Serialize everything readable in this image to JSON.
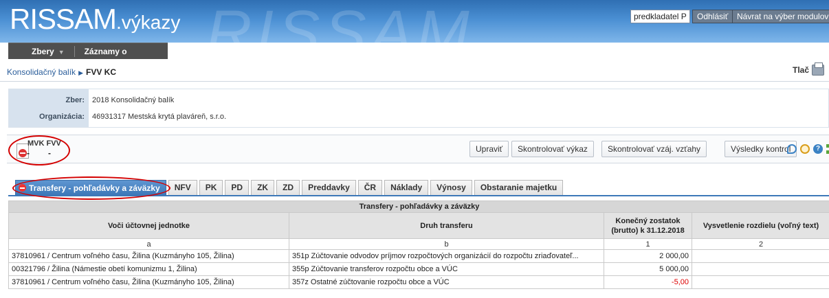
{
  "header": {
    "logo_main": "RISSAM",
    "logo_sub": ".výkazy",
    "watermark": "RISSAM",
    "user_value": "predkladatel P",
    "logout_label": "Odhlásiť",
    "back_label": "Návrat na výber modulov"
  },
  "nav": {
    "items": [
      "Zbery",
      "Záznamy o importe"
    ]
  },
  "breadcrumb": {
    "parent": "Konsolidačný balík",
    "current": "FVV KC",
    "print_label": "Tlač"
  },
  "info": {
    "zber_label": "Zber:",
    "zber_value": "2018 Konsolidačný balík",
    "org_label": "Organizácia:",
    "org_value": "46931317 Mestská krytá plaváreň, s.r.o."
  },
  "toolbar": {
    "names": "MVK  FVV",
    "dash1": "-",
    "dash2": "-",
    "buttons": [
      "Upraviť",
      "Skontrolovať výkaz",
      "Skontrolovať vzáj. vzťahy",
      "Výsledky kontrol"
    ],
    "help_glyph": "?"
  },
  "tabs": [
    "Transfery - pohľadávky a záväzky",
    "NFV",
    "PK",
    "PD",
    "ZK",
    "ZD",
    "Preddavky",
    "ČR",
    "Náklady",
    "Výnosy",
    "Obstaranie majetku"
  ],
  "table": {
    "title": "Transfery - pohľadávky a záväzky",
    "headers": [
      "Voči účtovnej jednotke",
      "Druh transferu",
      "Konečný zostatok (brutto) k 31.12.2018",
      "Vysvetlenie rozdielu (voľný text)"
    ],
    "letters": [
      "a",
      "b",
      "1",
      "2"
    ],
    "rows": [
      [
        "37810961 / Centrum voľného času, Žilina (Kuzmányho 105, Žilina)",
        "351p Zúčtovanie odvodov príjmov rozpočtových organizácií do rozpočtu zriaďovateľ...",
        "2 000,00",
        ""
      ],
      [
        "00321796 / Žilina (Námestie obetí komunizmu 1, Žilina)",
        "355p Zúčtovanie transferov rozpočtu obce a VÚC",
        "5 000,00",
        ""
      ],
      [
        "37810961 / Centrum voľného času, Žilina (Kuzmányho 105, Žilina)",
        "357z Ostatné zúčtovanie rozpočtu obce a VÚC",
        "-5,00",
        ""
      ]
    ]
  },
  "colors": {
    "header_blue": "#2f6fb3",
    "tab_active": "#3d78b8",
    "negative": "#dd0000",
    "annotation_red": "#d40000"
  }
}
